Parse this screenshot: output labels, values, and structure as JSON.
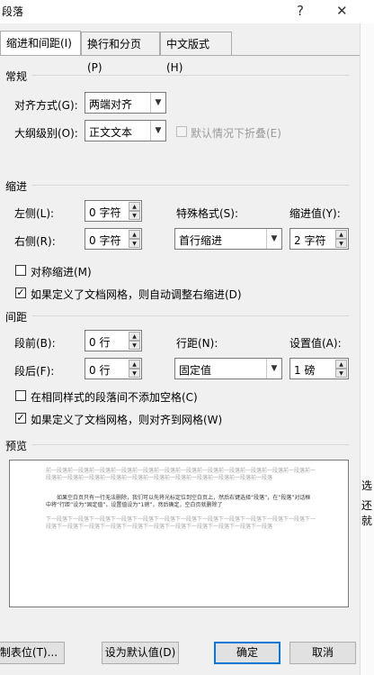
{
  "window": {
    "title": "段落",
    "help": "?",
    "close": "✕"
  },
  "tabs": [
    {
      "label": "缩进和间距(I)"
    },
    {
      "label": "换行和分页(P)"
    },
    {
      "label": "中文版式(H)"
    }
  ],
  "general": {
    "heading": "常规",
    "alignment_label": "对齐方式(G):",
    "alignment_value": "两端对齐",
    "outline_label": "大纲级别(O):",
    "outline_value": "正文文本",
    "collapse_label": "默认情况下折叠(E)"
  },
  "indent": {
    "heading": "缩进",
    "left_label": "左侧(L):",
    "left_value": "0 字符",
    "right_label": "右侧(R):",
    "right_value": "0 字符",
    "special_label": "特殊格式(S):",
    "special_value": "首行缩进",
    "by_label": "缩进值(Y):",
    "by_value": "2 字符",
    "mirror_label": "对称缩进(M)",
    "auto_adjust_label": "如果定义了文档网格，则自动调整右缩进(D)"
  },
  "spacing": {
    "heading": "间距",
    "before_label": "段前(B):",
    "before_value": "0 行",
    "after_label": "段后(F):",
    "after_value": "0 行",
    "line_label": "行距(N):",
    "line_value": "固定值",
    "at_label": "设置值(A):",
    "at_value": "1 磅",
    "no_space_label": "在相同样式的段落间不添加空格(C)",
    "snap_grid_label": "如果定义了文档网格，则对齐到网格(W)"
  },
  "preview": {
    "heading": "预览",
    "prev_text": "前一段落前一段落前一段落前一段落前一段落前一段落前一段落前一段落前一段落前一段落前一段落前一段落前一段落前一段落前一段落前一段落前一段落前一段落前一段落前一段落前一段落前一段落前一段落",
    "main_text": "如果空白页只有一行无法删除，我们可以先将光标定位到空白页上，然后右键选择“段落”，在“段落”对话框中将“行距”设为“固定值”，设置值设为“1磅”，然后确定，空白页就删除了",
    "next_text": "下一段落下一段落下一段落下一段落下一段落下一段落下一段落下一段落下一段落下一段落下一段落下一段落下一段落下一段落下一段落下一段落下一段落下一段落下一段落下一段落下一段落下一段落下一段落"
  },
  "buttons": {
    "tabs": "制表位(T)...",
    "set_default": "设为默认值(D)",
    "ok": "确定",
    "cancel": "取消"
  },
  "clipped_right": {
    "a": "选",
    "b": "还就"
  }
}
